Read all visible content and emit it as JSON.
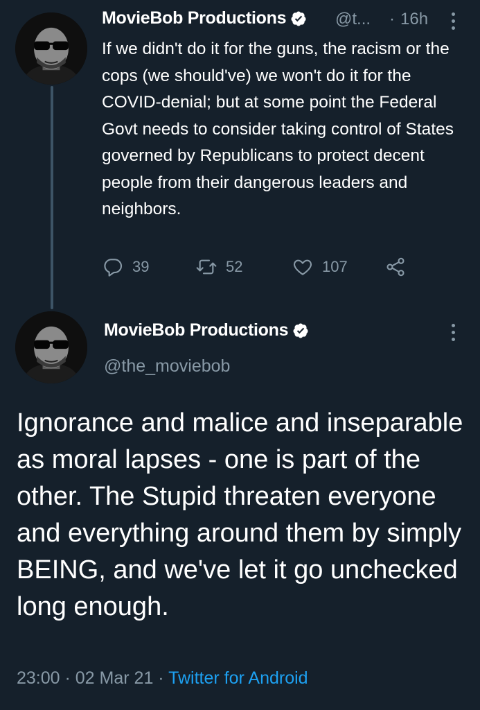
{
  "reply_tweet": {
    "display_name": "MovieBob Productions",
    "handle_truncated": "@t...",
    "separator": "·",
    "time_ago": "16h",
    "text": "If we didn't do it for the guns, the racism or the cops (we should've) we won't do it for the COVID-denial; but at some point the Federal Govt needs to consider taking control of States governed by Republicans to protect decent people from their dangerous leaders and neighbors.",
    "actions": {
      "replies": "39",
      "retweets": "52",
      "likes": "107"
    }
  },
  "main_tweet": {
    "display_name": "MovieBob Productions",
    "handle": "@the_moviebob",
    "text": "Ignorance and malice and inseparable as moral lapses - one is part of the other. The Stupid threaten everyone and everything around them by simply BEING, and we've let it go unchecked long enough.",
    "time": "23:00",
    "separator": " · ",
    "date": "02 Mar 21",
    "source": "Twitter for Android"
  },
  "colors": {
    "background": "#15202b",
    "text": "#ffffff",
    "secondary": "#8899a6",
    "accent": "#1da1f2",
    "thread_line": "#3d5466"
  },
  "icons": [
    "verified-badge-icon",
    "more-options-icon",
    "reply-icon",
    "retweet-icon",
    "like-icon",
    "share-icon"
  ]
}
